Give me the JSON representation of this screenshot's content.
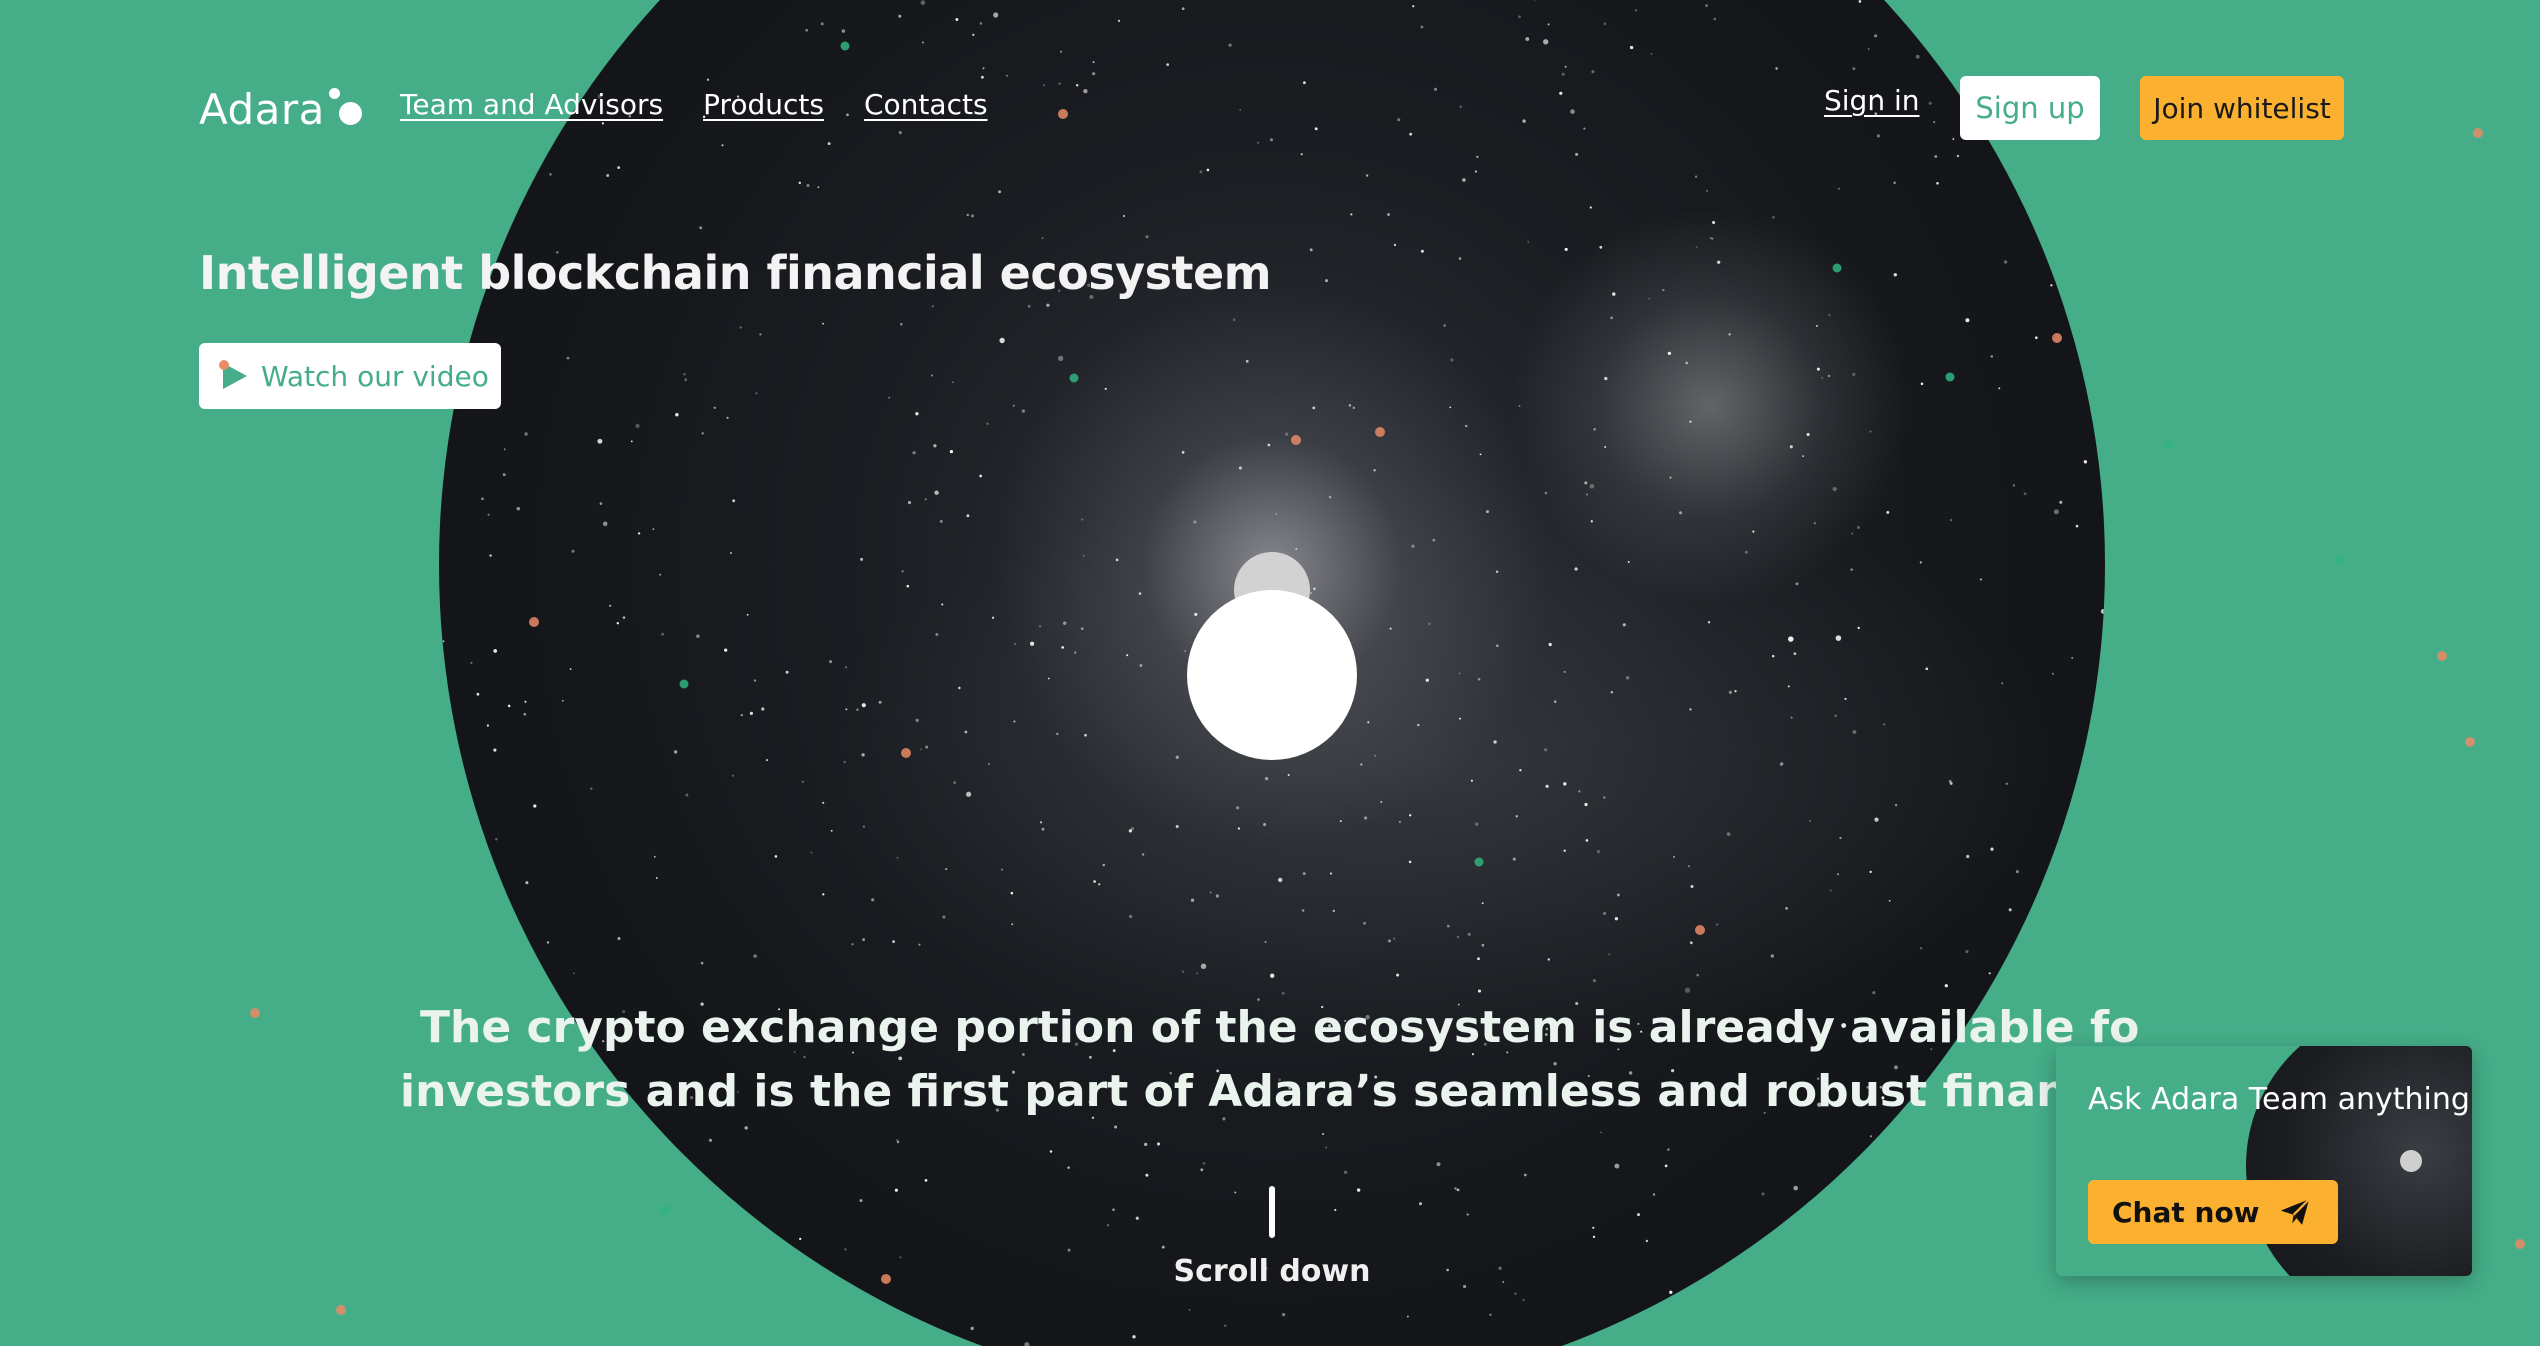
{
  "header": {
    "logo_text": "Adara",
    "nav": [
      {
        "label": "Team and Advisors"
      },
      {
        "label": "Products"
      },
      {
        "label": "Contacts"
      }
    ],
    "signin_label": "Sign in",
    "signup_label": "Sign up",
    "whitelist_label": "Join whitelist"
  },
  "hero": {
    "headline": "Intelligent blockchain financial ecosystem",
    "video_button_label": "Watch our video",
    "tagline_line1": "The crypto exchange portion of the ecosystem is already available for use by",
    "tagline_line2": "investors and is the first part of Adara’s seamless and robust financial solutions",
    "scroll_label": "Scroll down"
  },
  "chat_widget": {
    "title": "Ask Adara Team anything",
    "button_label": "Chat now",
    "icon": "paper-plane-icon"
  },
  "colors": {
    "background_green": "#45ad88",
    "accent_yellow": "#fbb12f",
    "sky_dark": "#15171b",
    "particle_orange": "#e98b66",
    "particle_green": "#2fb57f"
  }
}
